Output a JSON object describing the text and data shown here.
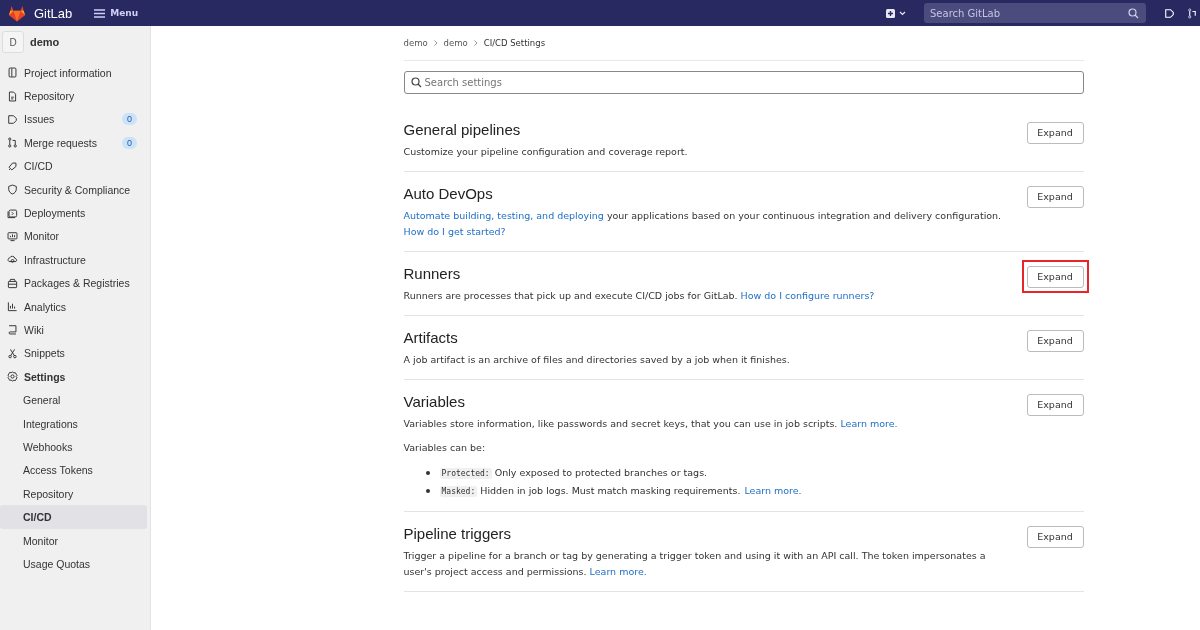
{
  "topbar": {
    "brand": "GitLab",
    "menu_label": "Menu",
    "search": {
      "placeholder": "Search GitLab"
    }
  },
  "sidebar": {
    "project": {
      "avatar": "D",
      "name": "demo"
    },
    "items": [
      {
        "label": "Project information",
        "selected": false
      },
      {
        "label": "Repository",
        "selected": false
      },
      {
        "label": "Issues",
        "badge": "0",
        "selected": false
      },
      {
        "label": "Merge requests",
        "badge": "0",
        "selected": false
      },
      {
        "label": "CI/CD",
        "selected": false
      },
      {
        "label": "Security & Compliance",
        "selected": false
      },
      {
        "label": "Deployments",
        "selected": false
      },
      {
        "label": "Monitor",
        "selected": false
      },
      {
        "label": "Infrastructure",
        "selected": false
      },
      {
        "label": "Packages & Registries",
        "selected": false
      },
      {
        "label": "Analytics",
        "selected": false
      },
      {
        "label": "Wiki",
        "selected": false
      },
      {
        "label": "Snippets",
        "selected": false
      },
      {
        "label": "Settings",
        "selected": false,
        "expanded": true,
        "children": [
          {
            "label": "General",
            "selected": false
          },
          {
            "label": "Integrations",
            "selected": false
          },
          {
            "label": "Webhooks",
            "selected": false
          },
          {
            "label": "Access Tokens",
            "selected": false
          },
          {
            "label": "Repository",
            "selected": false
          },
          {
            "label": "CI/CD",
            "selected": true
          },
          {
            "label": "Monitor",
            "selected": false
          },
          {
            "label": "Usage Quotas",
            "selected": false
          }
        ]
      }
    ]
  },
  "breadcrumbs": [
    "demo",
    "demo",
    "CI/CD Settings"
  ],
  "settings_search": {
    "placeholder": "Search settings"
  },
  "sections": [
    {
      "title": "General pipelines",
      "button": "Expand",
      "highlighted": false,
      "description": [
        {
          "kind": "text",
          "text": "Customize your pipeline configuration and coverage report."
        }
      ]
    },
    {
      "title": "Auto DevOps",
      "button": "Expand",
      "highlighted": false,
      "description": [
        {
          "kind": "link",
          "text": "Automate building, testing, and deploying"
        },
        {
          "kind": "text",
          "text": " your applications based on your continuous integration and delivery configuration. "
        },
        {
          "kind": "link",
          "text": "How do I get started?"
        }
      ]
    },
    {
      "title": "Runners",
      "button": "Expand",
      "highlighted": true,
      "description": [
        {
          "kind": "text",
          "text": "Runners are processes that pick up and execute CI/CD jobs for GitLab. "
        },
        {
          "kind": "link",
          "text": "How do I configure runners?"
        }
      ]
    },
    {
      "title": "Artifacts",
      "button": "Expand",
      "highlighted": false,
      "description": [
        {
          "kind": "text",
          "text": "A job artifact is an archive of files and directories saved by a job when it finishes."
        }
      ]
    },
    {
      "title": "Variables",
      "button": "Expand",
      "highlighted": false,
      "description": [
        {
          "kind": "text",
          "text": "Variables store information, like passwords and secret keys, that you can use in job scripts. "
        },
        {
          "kind": "link",
          "text": "Learn more."
        }
      ],
      "note": "Variables can be:",
      "bullets": [
        {
          "code": "Protected:",
          "text": "Only exposed to protected branches or tags."
        },
        {
          "code": "Masked:",
          "text": "Hidden in job logs. Must match masking requirements.",
          "link": "Learn more."
        }
      ]
    },
    {
      "title": "Pipeline triggers",
      "button": "Expand",
      "highlighted": false,
      "description": [
        {
          "kind": "text",
          "text": "Trigger a pipeline for a branch or tag by generating a trigger token and using it with an API call. The token impersonates a user's project access and permissions. "
        },
        {
          "kind": "link",
          "text": "Learn more."
        }
      ]
    }
  ]
}
